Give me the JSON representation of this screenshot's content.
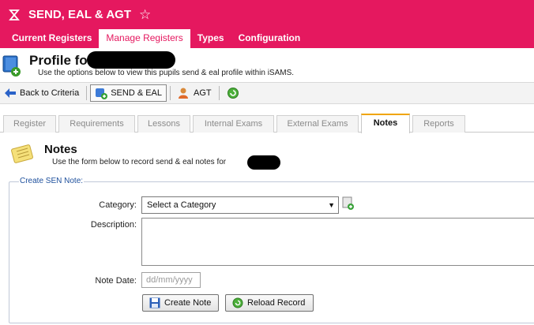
{
  "app": {
    "title": "SEND, EAL & AGT"
  },
  "nav": [
    {
      "label": "Current Registers"
    },
    {
      "label": "Manage Registers"
    },
    {
      "label": "Types"
    },
    {
      "label": "Configuration"
    }
  ],
  "profile": {
    "title": "Profile fo",
    "subtitle": "Use the options below to view this pupils send & eal profile within iSAMS."
  },
  "toolbar": {
    "back": "Back to Criteria",
    "send_eal": "SEND & EAL",
    "agt": "AGT"
  },
  "tabs": [
    {
      "label": "Register"
    },
    {
      "label": "Requirements"
    },
    {
      "label": "Lessons"
    },
    {
      "label": "Internal Exams"
    },
    {
      "label": "External Exams"
    },
    {
      "label": "Notes"
    },
    {
      "label": "Reports"
    }
  ],
  "notes": {
    "title": "Notes",
    "subtitle": "Use the form below to record send & eal notes for"
  },
  "form": {
    "legend": "Create SEN Note:",
    "category_label": "Category:",
    "category_value": "Select a Category",
    "description_label": "Description:",
    "date_label": "Note Date:",
    "date_placeholder": "dd/mm/yyyy",
    "create_button": "Create Note",
    "reload_button": "Reload Record"
  }
}
